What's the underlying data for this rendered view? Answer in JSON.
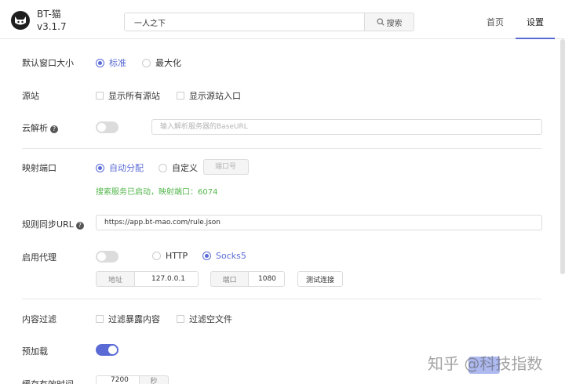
{
  "header": {
    "app_name": "BT-猫",
    "version": "v3.1.7",
    "search_value": "一人之下",
    "search_button": "搜索",
    "nav": {
      "home": "首页",
      "settings": "设置"
    }
  },
  "window_size": {
    "label": "默认窗口大小",
    "options": [
      "标准",
      "最大化"
    ],
    "selected": "标准"
  },
  "source_site": {
    "label": "源站",
    "options": [
      "显示所有源站",
      "显示源站入口"
    ]
  },
  "cloud_parse": {
    "label": "云解析",
    "enabled": false,
    "placeholder": "输入解析服务器的BaseURL"
  },
  "port_mapping": {
    "label": "映射端口",
    "options": [
      "自动分配",
      "自定义"
    ],
    "selected": "自动分配",
    "port_placeholder": "端口号",
    "status": "搜索服务已启动，映射端口：6074"
  },
  "rule_sync": {
    "label": "规则同步URL",
    "value": "https://app.bt-mao.com/rule.json"
  },
  "proxy": {
    "label": "启用代理",
    "enabled": false,
    "options": [
      "HTTP",
      "Socks5"
    ],
    "selected": "Socks5",
    "address_label": "地址",
    "address_value": "127.0.0.1",
    "port_label": "端口",
    "port_value": "1080",
    "test_button": "测试连接"
  },
  "content_filter": {
    "label": "内容过滤",
    "options": [
      "过滤暴露内容",
      "过滤空文件"
    ]
  },
  "preload": {
    "label": "预加载",
    "enabled": true
  },
  "cache_ttl": {
    "label": "缓存有效时间",
    "value": "7200",
    "unit": "秒"
  },
  "watermark": "知乎 @科技指数",
  "colors": {
    "accent": "#5a6bd6",
    "success": "#52b64a"
  }
}
